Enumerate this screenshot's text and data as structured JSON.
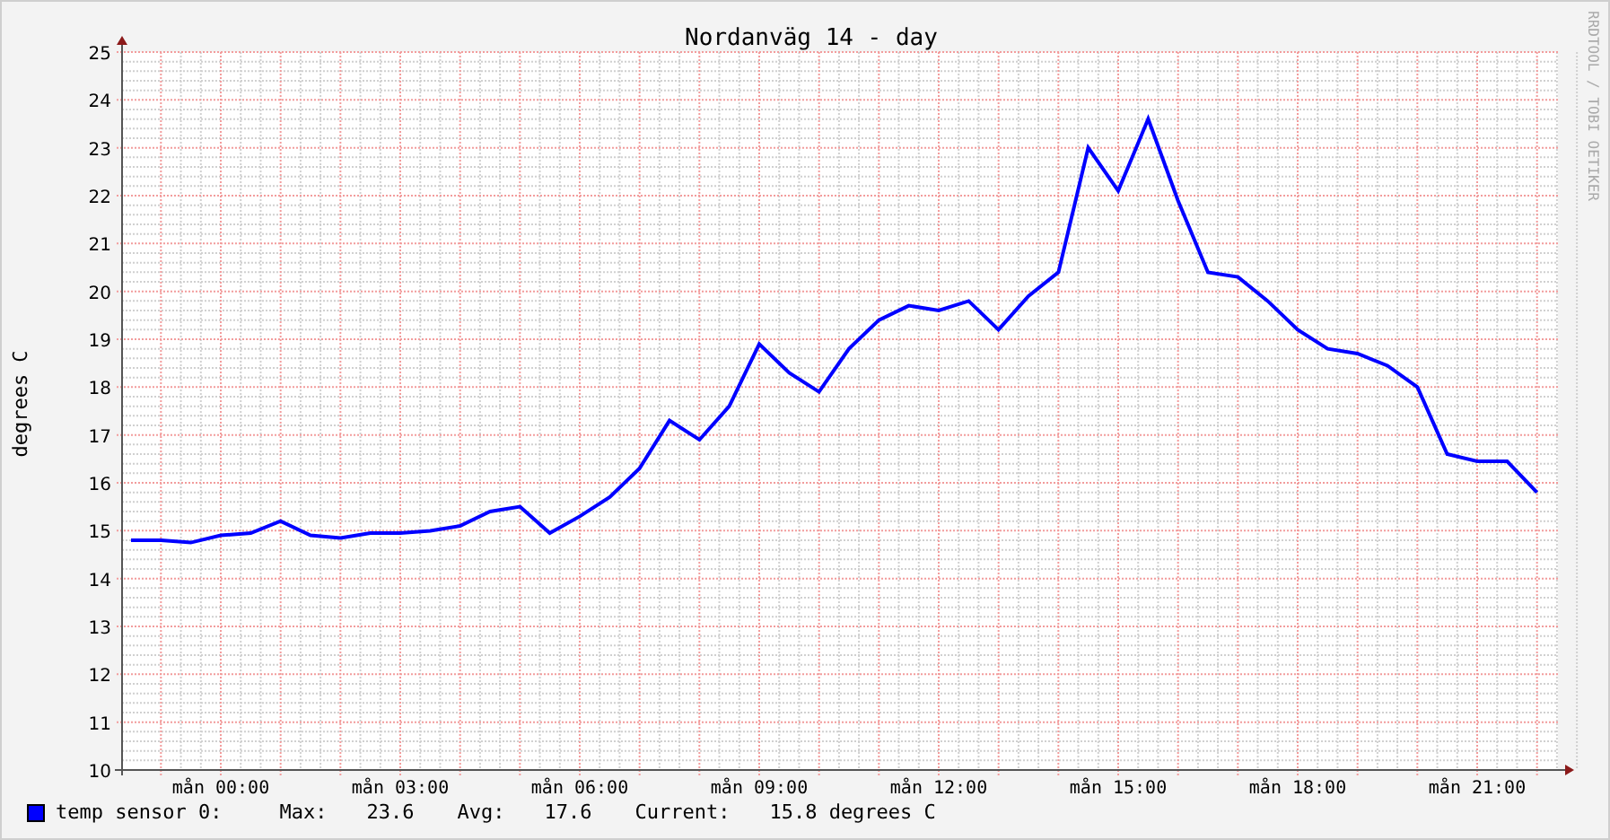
{
  "chart": {
    "credit": "RRDTOOL / TOBI OETIKER",
    "chart_data": {
      "type": "line",
      "title": "Nordanväg 14 - day",
      "ylabel": "degrees C",
      "categories": [
        null,
        null,
        null,
        "mån 00:00",
        null,
        null,
        null,
        null,
        null,
        "mån 03:00",
        null,
        null,
        null,
        null,
        null,
        "mån 06:00",
        null,
        null,
        null,
        null,
        null,
        "mån 09:00",
        null,
        null,
        null,
        null,
        null,
        "mån 12:00",
        null,
        null,
        null,
        null,
        null,
        "mån 15:00",
        null,
        null,
        null,
        null,
        null,
        "mån 18:00",
        null,
        null,
        null,
        null,
        null,
        "mån 21:00",
        null,
        null
      ],
      "series": [
        {
          "name": "temp sensor 0:",
          "color": "#0000ff",
          "values": [
            14.8,
            14.8,
            14.75,
            14.9,
            14.95,
            15.2,
            14.9,
            14.85,
            14.95,
            14.95,
            15.0,
            15.1,
            15.4,
            15.5,
            14.95,
            15.3,
            15.7,
            16.3,
            17.3,
            16.9,
            17.6,
            18.9,
            18.3,
            17.9,
            18.8,
            19.4,
            19.7,
            19.6,
            19.8,
            19.2,
            19.9,
            20.4,
            23.0,
            22.1,
            23.6,
            21.9,
            20.4,
            20.3,
            19.8,
            19.2,
            18.8,
            18.7,
            18.45,
            18.0,
            16.6,
            16.45,
            16.45,
            15.8
          ]
        }
      ],
      "grid": true,
      "ylim": [
        10,
        25
      ],
      "yticks": [
        10,
        11,
        12,
        13,
        14,
        15,
        16,
        17,
        18,
        19,
        20,
        21,
        22,
        23,
        24,
        25
      ]
    }
  },
  "legend": {
    "stats": [
      {
        "label": "Max:",
        "value": "23.6"
      },
      {
        "label": "Avg:",
        "value": "17.6"
      },
      {
        "label": "Current:",
        "value": "15.8 degrees C"
      }
    ]
  }
}
